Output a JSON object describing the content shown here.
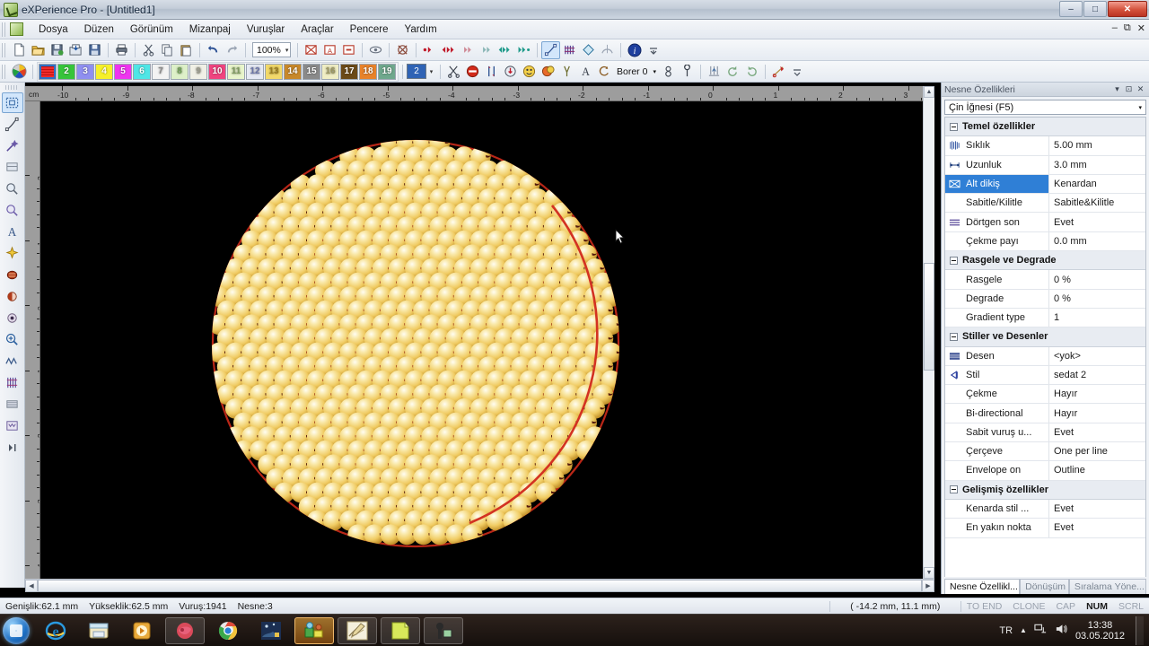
{
  "window": {
    "app_title": "eXPerience Pro - [Untitled1]",
    "minimize": "–",
    "maximize": "□",
    "close": "✕",
    "mdi_minimize": "–",
    "mdi_restore": "⧉",
    "mdi_close": "✕"
  },
  "menubar": {
    "items": [
      {
        "label": "Dosya"
      },
      {
        "label": "Düzen"
      },
      {
        "label": "Görünüm"
      },
      {
        "label": "Mizanpaj"
      },
      {
        "label": "Vuruşlar"
      },
      {
        "label": "Araçlar"
      },
      {
        "label": "Pencere"
      },
      {
        "label": "Yardım"
      }
    ]
  },
  "toolbar_main": {
    "zoom_value": "100%",
    "zoom_caret": "▾",
    "buttons": [
      {
        "name": "new-document-icon",
        "glyph": "🗋"
      },
      {
        "name": "open-folder-icon",
        "glyph": "🗁"
      },
      {
        "name": "save-as-icon",
        "glyph": "🖫"
      },
      {
        "name": "import-icon",
        "glyph": "🡇"
      },
      {
        "name": "save-icon",
        "glyph": "🖫"
      },
      {
        "name": "print-icon",
        "glyph": "🖨"
      },
      {
        "name": "cut-icon",
        "glyph": "✂"
      },
      {
        "name": "copy-icon",
        "glyph": "🗐"
      },
      {
        "name": "paste-icon",
        "glyph": "📋"
      },
      {
        "name": "undo-icon",
        "glyph": "↶"
      },
      {
        "name": "redo-icon",
        "glyph": "↷"
      },
      {
        "name": "show-hoop-icon",
        "glyph": "▧"
      },
      {
        "name": "show-grid-icon",
        "glyph": "A"
      },
      {
        "name": "show-outline-icon",
        "glyph": "⊟"
      },
      {
        "name": "preview-eye-icon",
        "glyph": "👁"
      },
      {
        "name": "hoop-center-icon",
        "glyph": "✖"
      },
      {
        "name": "stitch-red-small-icon",
        "glyph": "◆"
      },
      {
        "name": "stitch-red-double-icon",
        "glyph": "◆◆"
      },
      {
        "name": "stitch-pink-icon",
        "glyph": "◆"
      },
      {
        "name": "stitch-teal-icon",
        "glyph": "◆"
      },
      {
        "name": "stitch-green-double-icon",
        "glyph": "◆◆"
      },
      {
        "name": "stitch-green-pair-icon",
        "glyph": "◆◆"
      },
      {
        "name": "node-edit-icon",
        "glyph": "⟋"
      },
      {
        "name": "stitch-view-icon",
        "glyph": "⦀"
      },
      {
        "name": "rotate-shape-icon",
        "glyph": "◇"
      },
      {
        "name": "mirror-icon",
        "glyph": "⌂"
      },
      {
        "name": "info-icon",
        "glyph": "i"
      }
    ]
  },
  "palette": {
    "color_wheel_name": "color-wheel-icon",
    "selected_index": 1,
    "swatches": [
      {
        "label": "1",
        "color": "#ef2b2b",
        "text": "#ffffff"
      },
      {
        "label": "2",
        "color": "#36c43a",
        "text": "#ffffff"
      },
      {
        "label": "3",
        "color": "#8f8ff0",
        "text": "#ffffff"
      },
      {
        "label": "4",
        "color": "#f5f02a",
        "text": "#ffffff"
      },
      {
        "label": "5",
        "color": "#ef34ef",
        "text": "#ffffff"
      },
      {
        "label": "6",
        "color": "#4fe6e6",
        "text": "#ffffff"
      },
      {
        "label": "7",
        "color": "#f3f3f3",
        "text": "#8a8a8a"
      },
      {
        "label": "8",
        "color": "#ddf0c8",
        "text": "#6f9f55"
      },
      {
        "label": "9",
        "color": "#f0f0e6",
        "text": "#9a9a8a"
      },
      {
        "label": "10",
        "color": "#f0447f",
        "text": "#ffffff"
      },
      {
        "label": "11",
        "color": "#e8f5cb",
        "text": "#7d9a5e"
      },
      {
        "label": "12",
        "color": "#e6eaf5",
        "text": "#6a74a8"
      },
      {
        "label": "13",
        "color": "#f2d96a",
        "text": "#9a7d20"
      },
      {
        "label": "14",
        "color": "#c8882a",
        "text": "#ffffff"
      },
      {
        "label": "15",
        "color": "#8a8a8a",
        "text": "#ffffff"
      },
      {
        "label": "16",
        "color": "#f0eec4",
        "text": "#9a9560"
      },
      {
        "label": "17",
        "color": "#6b4a18",
        "text": "#ffffff"
      },
      {
        "label": "18",
        "color": "#e8822a",
        "text": "#ffffff"
      },
      {
        "label": "19",
        "color": "#6fa88d",
        "text": "#ffffff"
      }
    ]
  },
  "toolbar_stitch": {
    "needle_index": "2",
    "needle_caret": "▾",
    "borer_label": "Borer 0",
    "borer_caret": "▾",
    "buttons": [
      {
        "name": "trim-scissors-icon",
        "glyph": "✂"
      },
      {
        "name": "stop-icon",
        "glyph": "⊗"
      },
      {
        "name": "needle-up-icon",
        "glyph": "⇅"
      },
      {
        "name": "needle-set-icon",
        "glyph": "◉"
      },
      {
        "name": "sequin-icon",
        "glyph": "☺"
      },
      {
        "name": "sequin-double-icon",
        "glyph": "☻"
      },
      {
        "name": "boring-icon",
        "glyph": "⊻"
      },
      {
        "name": "text-icon",
        "glyph": "A"
      },
      {
        "name": "thread-loop-icon",
        "glyph": "↺"
      },
      {
        "name": "needle-bar-icon",
        "glyph": "8"
      },
      {
        "name": "cording-icon",
        "glyph": "℘"
      },
      {
        "name": "stitch-chart-icon",
        "glyph": "⊥"
      },
      {
        "name": "rotate-ccw-icon",
        "glyph": "↺"
      },
      {
        "name": "rotate-cw-icon",
        "glyph": "↻"
      },
      {
        "name": "thread-cut-icon",
        "glyph": "✎"
      }
    ]
  },
  "left_rail": {
    "buttons": [
      {
        "name": "select-rectangle-tool",
        "glyph": "⬚",
        "active": true
      },
      {
        "name": "node-select-tool",
        "glyph": "⟋"
      },
      {
        "name": "magic-wand-tool",
        "glyph": "✦"
      },
      {
        "name": "reshape-tool",
        "glyph": "▨"
      },
      {
        "name": "measure-tool",
        "glyph": "🔎"
      },
      {
        "name": "zoom-area-tool",
        "glyph": "🔍"
      },
      {
        "name": "text-tool",
        "glyph": "A"
      },
      {
        "name": "autodigitize-tool",
        "glyph": "✶"
      },
      {
        "name": "ellipse-fill-tool",
        "glyph": "●"
      },
      {
        "name": "circle-partial-tool",
        "glyph": "◑"
      },
      {
        "name": "point-tool",
        "glyph": "◎"
      },
      {
        "name": "zoom-in-tool",
        "glyph": "⊕"
      },
      {
        "name": "run-stitch-tool",
        "glyph": "〰"
      },
      {
        "name": "satin-stitch-tool",
        "glyph": "⋔"
      },
      {
        "name": "fill-stitch-tool",
        "glyph": "▤"
      },
      {
        "name": "motif-stitch-tool",
        "glyph": "▦"
      }
    ]
  },
  "rulers": {
    "unit": "cm",
    "h_labels": [
      "-10",
      "-9",
      "-8",
      "-7",
      "-6",
      "-5",
      "-4",
      "-3",
      "-2",
      "-1",
      "0",
      "1",
      "2",
      "3"
    ],
    "v_labels": [
      "2",
      "1",
      "0",
      "-1",
      "-2",
      "-3",
      "-4"
    ]
  },
  "properties": {
    "title": "Nesne Özellikleri",
    "header_buttons": {
      "menu": "▾",
      "pin": "⊡",
      "close": "✕"
    },
    "object_type": "Çin İğnesi (F5)",
    "object_type_caret": "▾",
    "groups": [
      {
        "title": "Temel özellikler",
        "rows": [
          {
            "icon": "density-icon",
            "name": "Sıklık",
            "value": "5.00 mm",
            "selected": false
          },
          {
            "icon": "length-icon",
            "name": "Uzunluk",
            "value": "3.0 mm",
            "selected": false
          },
          {
            "icon": "underlay-icon",
            "name": "Alt dikiş",
            "value": "Kenardan",
            "selected": true
          },
          {
            "icon": "",
            "name": "Sabitle/Kilitle",
            "value": "Sabitle&Kilitle",
            "selected": false
          },
          {
            "icon": "rectangle-end-icon",
            "name": "Dörtgen son",
            "value": "Evet",
            "selected": false
          },
          {
            "icon": "",
            "name": "Çekme payı",
            "value": "0.0 mm",
            "selected": false
          }
        ]
      },
      {
        "title": "Rasgele ve Degrade",
        "rows": [
          {
            "icon": "",
            "name": "Rasgele",
            "value": "0 %",
            "selected": false
          },
          {
            "icon": "",
            "name": "Degrade",
            "value": "0 %",
            "selected": false
          },
          {
            "icon": "",
            "name": "Gradient type",
            "value": "1",
            "selected": false
          }
        ]
      },
      {
        "title": "Stiller ve Desenler",
        "rows": [
          {
            "icon": "pattern-icon",
            "name": "Desen",
            "value": "<yok>",
            "selected": false
          },
          {
            "icon": "style-icon",
            "name": "Stil",
            "value": "sedat 2",
            "selected": false
          },
          {
            "icon": "",
            "name": "Çekme",
            "value": "Hayır",
            "selected": false
          },
          {
            "icon": "",
            "name": "Bi-directional",
            "value": "Hayır",
            "selected": false
          },
          {
            "icon": "",
            "name": "Sabit vuruş u...",
            "value": "Evet",
            "selected": false
          },
          {
            "icon": "",
            "name": "Çerçeve",
            "value": "One per line",
            "selected": false
          },
          {
            "icon": "",
            "name": "Envelope on",
            "value": "Outline",
            "selected": false
          }
        ]
      },
      {
        "title": "Gelişmiş özellikler",
        "rows": [
          {
            "icon": "",
            "name": "Kenarda stil ...",
            "value": "Evet",
            "selected": false
          },
          {
            "icon": "",
            "name": "En yakın nokta",
            "value": "Evet",
            "selected": false
          }
        ]
      }
    ],
    "tabs": [
      {
        "label": "Nesne Özellikl...",
        "active": true
      },
      {
        "label": "Dönüşüm",
        "active": false
      },
      {
        "label": "Sıralama Yöne...",
        "active": false
      }
    ]
  },
  "statusbar": {
    "width_label": "Genişlik:62.1 mm",
    "height_label": "Yükseklik:62.5 mm",
    "stitches_label": "Vuruş:1941",
    "objects_label": "Nesne:3",
    "coordinates": "(  -14.2 mm,    11.1 mm)",
    "indicators": [
      {
        "label": "TO END",
        "on": false
      },
      {
        "label": "CLONE",
        "on": false
      },
      {
        "label": "CAP",
        "on": false
      },
      {
        "label": "NUM",
        "on": true
      },
      {
        "label": "SCRL",
        "on": false
      }
    ]
  },
  "taskbar": {
    "start_name": "start-orb",
    "apps": [
      {
        "name": "internet-explorer-icon",
        "framed": false,
        "hot": false
      },
      {
        "name": "file-explorer-icon",
        "framed": false,
        "hot": false
      },
      {
        "name": "media-player-icon",
        "framed": false,
        "hot": false
      },
      {
        "name": "firefox-icon",
        "framed": true,
        "hot": false
      },
      {
        "name": "chrome-icon",
        "framed": false,
        "hot": false
      },
      {
        "name": "blue-app-icon",
        "framed": false,
        "hot": false
      },
      {
        "name": "experience-pro-icon",
        "framed": false,
        "hot": true
      },
      {
        "name": "design-app-icon",
        "framed": true,
        "hot": false
      },
      {
        "name": "notes-app-icon",
        "framed": true,
        "hot": false
      },
      {
        "name": "camera-app-icon",
        "framed": true,
        "hot": false
      }
    ],
    "tray_language": "TR",
    "tray_arrow": "▲",
    "tray_network": "network-icon",
    "tray_volume": "volume-icon",
    "clock_time": "13:38",
    "clock_date": "03.05.2012"
  },
  "design": {
    "description": "Circular dense bead-stitch embroidery pattern",
    "bead_color": "#f2d57a",
    "bead_highlight": "#fdf3c8",
    "bead_shadow": "#c79a2e",
    "accent_color": "#8d1a10",
    "outline_color": "#cc2a1a",
    "background": "#000000"
  }
}
